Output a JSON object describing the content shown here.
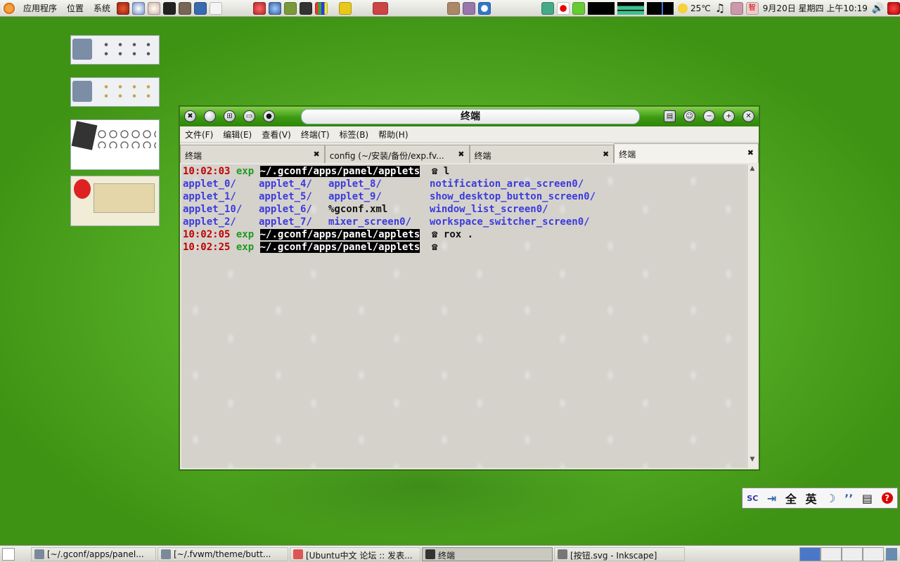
{
  "top_panel": {
    "menus": [
      "应用程序",
      "位置",
      "系统"
    ],
    "weather": "25℃",
    "datetime": "9月20日 星期四 上午10:19"
  },
  "window": {
    "title": "终端",
    "menus": [
      "文件(F)",
      "编辑(E)",
      "查看(V)",
      "终端(T)",
      "标签(B)",
      "帮助(H)"
    ],
    "tabs": [
      {
        "label": "终端"
      },
      {
        "label": "config (~/安装/备份/exp.fv..."
      },
      {
        "label": "终端"
      },
      {
        "label": "终端"
      }
    ],
    "prompt": {
      "time1": "10:02:03",
      "time2": "10:02:05",
      "time3": "10:02:25",
      "user": "exp",
      "path": "~/.gconf/apps/panel/applets",
      "symbol": "☎"
    },
    "commands": {
      "c1": "l",
      "c2": "rox ."
    },
    "listing": {
      "col1": [
        "applet_0/",
        "applet_1/",
        "applet_10/",
        "applet_2/"
      ],
      "col2": [
        "applet_4/",
        "applet_5/",
        "applet_6/",
        "applet_7/"
      ],
      "col3": [
        "applet_8/",
        "applet_9/",
        "%gconf.xml",
        "mixer_screen0/"
      ],
      "col4": [
        "notification_area_screen0/",
        "show_desktop_button_screen0/",
        "window_list_screen0/",
        "workspace_switcher_screen0/"
      ]
    }
  },
  "ime": {
    "full": "全",
    "lang": "英"
  },
  "taskbar": {
    "tasks": [
      "[~/.gconf/apps/panel...",
      "[~/.fvwm/theme/butt...",
      "[Ubuntu中文 论坛 :: 发表...",
      "终端",
      "[按钮.svg - Inkscape]"
    ]
  },
  "colors": {
    "accent_green": "#3c9a12",
    "prompt_time": "#c00000",
    "prompt_user": "#1f9a1f",
    "dir": "#3b3bdc"
  }
}
